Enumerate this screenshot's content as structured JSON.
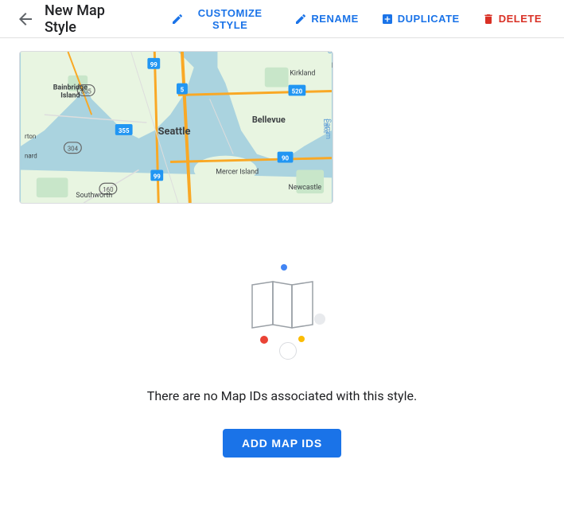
{
  "header": {
    "back_icon": "←",
    "title": "New Map Style",
    "actions": [
      {
        "id": "customize",
        "label": "CUSTOMIZE STYLE",
        "icon": "✏️",
        "type": "primary"
      },
      {
        "id": "rename",
        "label": "RENAME",
        "icon": "✏️",
        "type": "primary"
      },
      {
        "id": "duplicate",
        "label": "DUPLICATE",
        "icon": "⊞",
        "type": "primary"
      },
      {
        "id": "delete",
        "label": "DELETE",
        "icon": "🗑",
        "type": "delete"
      }
    ]
  },
  "empty_state": {
    "message": "There are no Map IDs associated with this style.",
    "add_button_label": "ADD MAP IDS"
  },
  "dots": {
    "blue": "#4285f4",
    "green": "#34a853",
    "red": "#ea4335",
    "yellow": "#fbbc04",
    "gray": "#dadce0"
  }
}
